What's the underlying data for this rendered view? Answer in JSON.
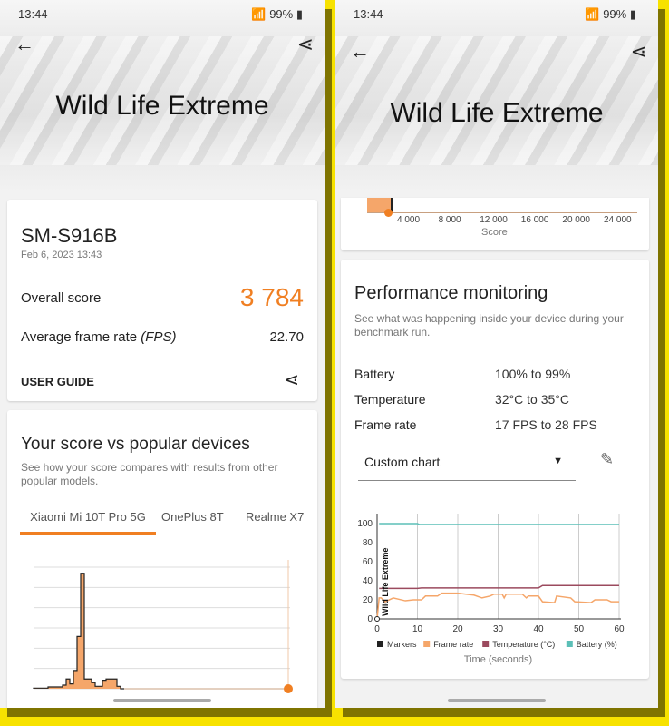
{
  "status": {
    "time": "13:44",
    "battery": "99%"
  },
  "header": {
    "title": "Wild Life Extreme"
  },
  "result": {
    "device": "SM-S916B",
    "date": "Feb 6, 2023 13:43",
    "overall_label": "Overall score",
    "overall_value": "3 784",
    "fps_label": "Average frame rate",
    "fps_unit": "(FPS)",
    "fps_value": "22.70",
    "user_guide": "USER GUIDE"
  },
  "compare": {
    "title": "Your score vs popular devices",
    "subtitle": "See how your score compares with results from other popular models.",
    "tabs": [
      {
        "label": "Xiaomi Mi 10T Pro 5G",
        "active": true
      },
      {
        "label": "OnePlus 8T"
      },
      {
        "label": "Realme X7"
      }
    ]
  },
  "score_axis": {
    "ticks": [
      "4 000",
      "8 000",
      "12 000",
      "16 000",
      "20 000",
      "24 000"
    ],
    "label": "Score"
  },
  "perf": {
    "title": "Performance monitoring",
    "subtitle": "See what was happening inside your device during your benchmark run.",
    "rows": [
      {
        "label": "Battery",
        "value": "100% to 99%"
      },
      {
        "label": "Temperature",
        "value": "32°C to 35°C"
      },
      {
        "label": "Frame rate",
        "value": "17 FPS to 28 FPS"
      }
    ],
    "chart_select": "Custom chart"
  },
  "colors": {
    "accent": "#f07f22",
    "framerate": "#f5a66a",
    "temperature": "#9b4a5e",
    "battery": "#5bbfb7",
    "markers": "#222222"
  },
  "chart_data": [
    {
      "type": "bar",
      "description_source": "histogram",
      "values": [
        0.5,
        0.5,
        0.5,
        0.5,
        1.5,
        1.5,
        1.5,
        1.5,
        3,
        8,
        4,
        15,
        43,
        95,
        8,
        8,
        5,
        2,
        2,
        7,
        8,
        8,
        8,
        2,
        0
      ],
      "your_score_marker": "3 784"
    },
    {
      "type": "line",
      "xlabel": "Time (seconds)",
      "ylabel": "",
      "xlim": [
        0,
        60
      ],
      "ylim": [
        0,
        100
      ],
      "xticks": [
        0,
        10,
        20,
        30,
        40,
        50,
        60
      ],
      "yticks": [
        0,
        20,
        40,
        60,
        80,
        100
      ],
      "grid": "vertical",
      "legend": "bottom",
      "marker_label": "Wild Life Extreme",
      "legend_entries": [
        "Markers",
        "Frame rate",
        "Temperature (°C)",
        "Battery (%)"
      ],
      "series": [
        {
          "name": "Frame rate",
          "x": [
            0,
            0.5,
            1,
            2,
            4,
            5,
            7,
            9,
            11,
            12,
            15,
            16,
            20,
            22,
            24,
            26,
            28,
            29,
            31,
            31.5,
            32,
            36,
            37,
            37.5,
            40,
            41,
            44,
            44.5,
            48,
            49,
            53,
            54,
            57,
            58,
            60
          ],
          "y": [
            0,
            22,
            22,
            18,
            22,
            21,
            19,
            20,
            20,
            24,
            24,
            27,
            27,
            26,
            25,
            22,
            24,
            26,
            26,
            22,
            26,
            26,
            22,
            24,
            24,
            18,
            17,
            24,
            22,
            18,
            17,
            20,
            20,
            18,
            18
          ]
        },
        {
          "name": "Temperature (°C)",
          "x": [
            0.5,
            10,
            11,
            40,
            41,
            60
          ],
          "y": [
            32,
            32,
            32.5,
            32.5,
            35,
            35
          ]
        },
        {
          "name": "Battery (%)",
          "x": [
            0.5,
            10,
            10.5,
            60
          ],
          "y": [
            100,
            100,
            99,
            99
          ]
        }
      ]
    }
  ]
}
